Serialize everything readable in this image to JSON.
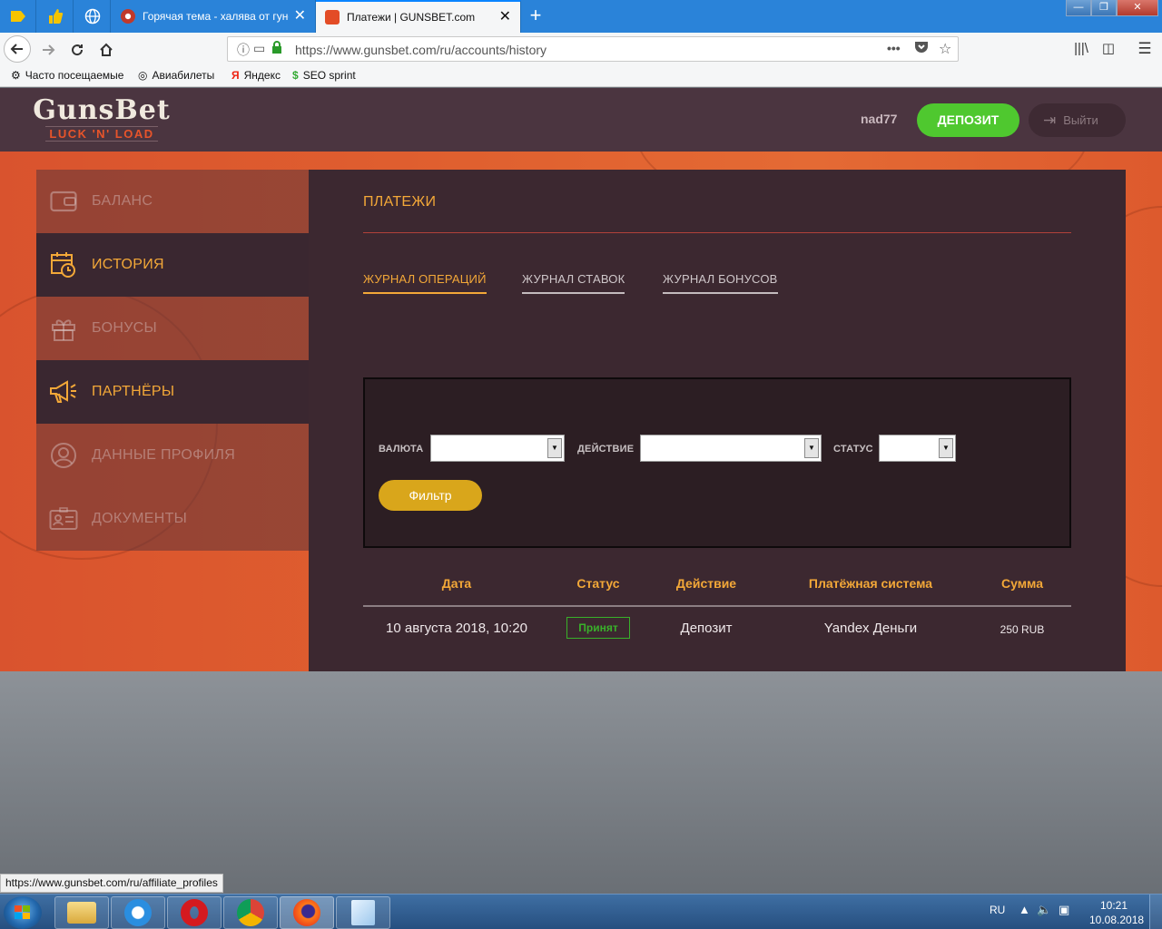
{
  "browser": {
    "tabs": [
      {
        "title": "Горячая тема - халява от гунсбет",
        "active": false
      },
      {
        "title": "Платежи | GUNSBET.com",
        "active": true
      }
    ],
    "new_tab": "+",
    "window_controls": {
      "minimize": "—",
      "restore": "❐",
      "close": "✕"
    },
    "url": "https://www.gunsbet.com/ru/accounts/history",
    "bookmarks": [
      "Часто посещаемые",
      "Авиабилеты",
      "Яндекс",
      "SEO sprint"
    ],
    "status_url": "https://www.gunsbet.com/ru/affiliate_profiles"
  },
  "site": {
    "logo_main": "GunsBet",
    "logo_sub": "LUCK 'N' LOAD",
    "username": "nad77",
    "deposit_label": "ДЕПОЗИТ",
    "logout_label": "Выйти"
  },
  "sidebar": {
    "items": [
      {
        "label": "БАЛАНС",
        "icon": "wallet-icon",
        "active": false
      },
      {
        "label": "ИСТОРИЯ",
        "icon": "calendar-clock-icon",
        "active": true
      },
      {
        "label": "БОНУСЫ",
        "icon": "gift-icon",
        "active": false
      },
      {
        "label": "ПАРТНЁРЫ",
        "icon": "megaphone-icon",
        "active": true
      },
      {
        "label": "ДАННЫЕ ПРОФИЛЯ",
        "icon": "user-icon",
        "active": false
      },
      {
        "label": "ДОКУМЕНТЫ",
        "icon": "id-card-icon",
        "active": false
      }
    ]
  },
  "panel": {
    "title": "ПЛАТЕЖИ",
    "tabs": [
      "ЖУРНАЛ ОПЕРАЦИЙ",
      "ЖУРНАЛ СТАВОК",
      "ЖУРНАЛ БОНУСОВ"
    ],
    "filter": {
      "currency_label": "ВАЛЮТА",
      "action_label": "ДЕЙСТВИЕ",
      "status_label": "СТАТУС",
      "currency_value": "",
      "action_value": "",
      "status_value": "",
      "button": "Фильтр"
    },
    "table": {
      "headers": [
        "Дата",
        "Статус",
        "Действие",
        "Платёжная система",
        "Сумма"
      ],
      "rows": [
        {
          "date": "10 августа 2018, 10:20",
          "status": "Принят",
          "action": "Депозит",
          "system": "Yandex Деньги",
          "amount": "250 RUB"
        }
      ]
    }
  },
  "taskbar": {
    "lang": "RU",
    "time": "10:21",
    "date": "10.08.2018"
  },
  "colors": {
    "accent_orange": "#f3a838",
    "deposit_green": "#4fc82f",
    "filter_gold": "#d9a61b",
    "status_green": "#39b12a",
    "header_bg": "#4b3540",
    "panel_bg": "#3c2830"
  }
}
